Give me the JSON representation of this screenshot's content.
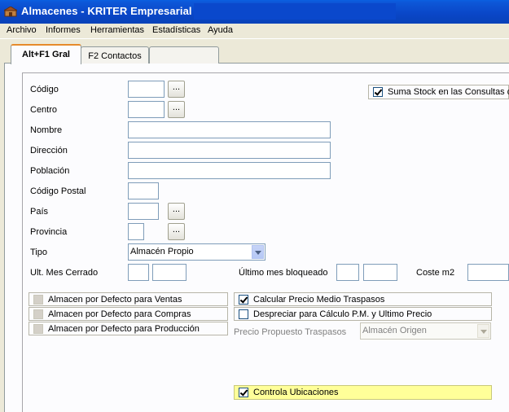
{
  "window": {
    "title": "Almacenes - KRITER Empresarial -"
  },
  "menu": [
    "Archivo",
    "Informes",
    "Herramientas",
    "Estadísticas",
    "Ayuda"
  ],
  "tabs": [
    "Alt+F1 Gral",
    "F2 Contactos"
  ],
  "labels": {
    "codigo": "Código",
    "centro": "Centro",
    "nombre": "Nombre",
    "direccion": "Dirección",
    "poblacion": "Población",
    "codigo_postal": "Código Postal",
    "pais": "País",
    "provincia": "Provincia",
    "tipo": "Tipo",
    "ult_mes_cerrado": "Ult. Mes Cerrado",
    "ultimo_mes_bloqueado": "Último mes bloqueado",
    "coste_m2": "Coste m2",
    "precio_propuesto": "Precio Propuesto Traspasos"
  },
  "browse_label": "...",
  "tipo_value": "Almacén Propio",
  "precio_propuesto_value": "Almacén Origen",
  "checks": {
    "suma_stock": "Suma Stock en las Consultas d",
    "defecto_ventas": "Almacen por Defecto para Ventas",
    "defecto_compras": "Almacen por Defecto para Compras",
    "defecto_produccion": "Almacen por Defecto para Producción",
    "calcular_precio": "Calcular Precio Medio Traspasos",
    "despreciar": "Despreciar para Cálculo P.M. y Ultimo Precio",
    "controla_ubicaciones": "Controla Ubicaciones"
  },
  "colors": {
    "title_bar": "#0a46c7",
    "highlight_row": "#ffff99",
    "tab_accent": "#e68b2c"
  }
}
